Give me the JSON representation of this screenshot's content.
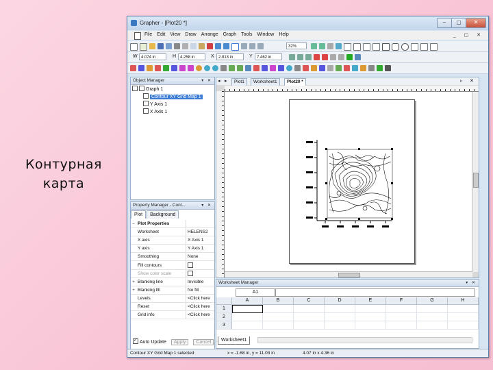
{
  "slide": {
    "caption": "Контурная карта"
  },
  "window": {
    "title": "Grapher - [Plot20 *]",
    "min_label": "–",
    "max_label": "▢",
    "close_label": "✕"
  },
  "menu": {
    "items": [
      "File",
      "Edit",
      "View",
      "Draw",
      "Arrange",
      "Graph",
      "Tools",
      "Window",
      "Help"
    ],
    "mdi_controls": "_ ▢ ✕"
  },
  "toolbar": {
    "zoom": "32%",
    "w_label": "W",
    "w_value": "4.074 in",
    "h_label": "H",
    "h_value": "4.258 in",
    "x_label": "X",
    "x_value": "2.813 in",
    "y_label": "Y",
    "y_value": "7.462 in"
  },
  "object_manager": {
    "title": "Object Manager",
    "controls": "▾ ✕",
    "items": [
      {
        "label": "Graph 1"
      },
      {
        "label": "Contour XY Grid Map 1"
      },
      {
        "label": "Y Axis 1"
      },
      {
        "label": "X Axis 1"
      }
    ]
  },
  "property_manager": {
    "title": "Property Manager - Cont...",
    "controls": "▾ ✕",
    "tabs": [
      "Plot",
      "Background"
    ],
    "rows": [
      {
        "expander": "–",
        "name": "Plot Properties",
        "value": "",
        "group": true
      },
      {
        "expander": "",
        "name": "Worksheet",
        "value": "HELENS2"
      },
      {
        "expander": "",
        "name": "X axis",
        "value": "X Axis 1"
      },
      {
        "expander": "",
        "name": "Y axis",
        "value": "Y Axis 1"
      },
      {
        "expander": "",
        "name": "Smoothing",
        "value": "None"
      },
      {
        "expander": "",
        "name": "Fill contours",
        "value": "",
        "checkbox": true
      },
      {
        "expander": "",
        "name": "Show color scale",
        "value": "",
        "checkbox": true,
        "disabled": true
      },
      {
        "expander": "+",
        "name": "Blanking line",
        "value": "Invisible"
      },
      {
        "expander": "+",
        "name": "Blanking fill",
        "value": "No fill"
      },
      {
        "expander": "",
        "name": "Levels",
        "value": "<Click here"
      },
      {
        "expander": "",
        "name": "Reset",
        "value": "<Click here"
      },
      {
        "expander": "",
        "name": "Grid info",
        "value": "<Click here"
      }
    ],
    "auto_update_label": "Auto Update",
    "apply_label": "Apply",
    "cancel_label": "Cancel"
  },
  "document_tabs": [
    "Plot1",
    "Worksheet1",
    "Plot20 *"
  ],
  "worksheet_manager": {
    "title": "Worksheet Manager",
    "controls": "▾ ✕",
    "cell_ref": "A1",
    "columns": [
      "A",
      "B",
      "C",
      "D",
      "E",
      "F",
      "G",
      "H"
    ],
    "rows": [
      "1",
      "2",
      "3"
    ],
    "sheet_tab": "Worksheet1"
  },
  "status_bar": {
    "selection": "Contour XY Grid Map 1 selected",
    "cursor": "x = -1.68 in, y = 11.03 in",
    "size": "4.07 in x 4.36 in"
  },
  "colors": {
    "title_bar": "#c3d6ec",
    "selection": "#3a7bd5",
    "close_button": "#c8503a"
  }
}
